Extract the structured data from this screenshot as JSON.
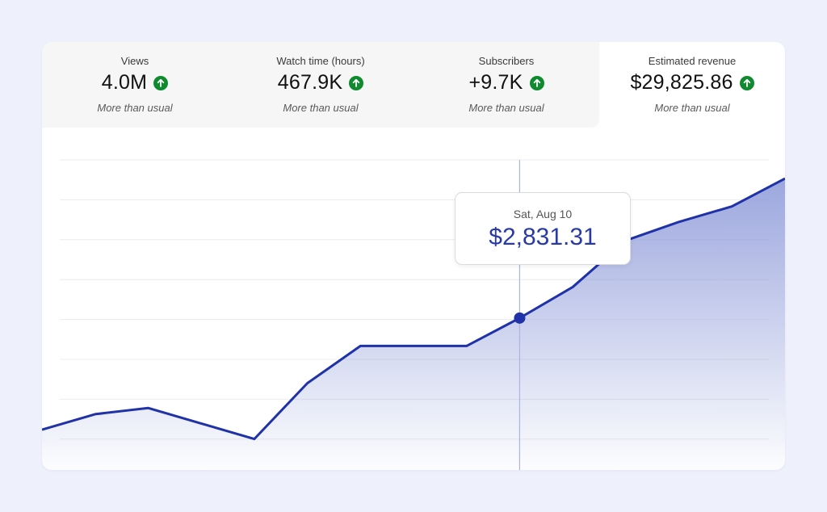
{
  "metrics": [
    {
      "label": "Views",
      "value": "4.0M",
      "note": "More than usual",
      "trend": "up-arrow-icon"
    },
    {
      "label": "Watch time (hours)",
      "value": "467.9K",
      "note": "More than usual",
      "trend": "up-arrow-icon"
    },
    {
      "label": "Subscribers",
      "value": "+9.7K",
      "note": "More than usual",
      "trend": "up-arrow-icon"
    },
    {
      "label": "Estimated revenue",
      "value": "$29,825.86",
      "note": "More than usual",
      "trend": "up-arrow-icon"
    }
  ],
  "selected_metric": "Estimated revenue",
  "tooltip": {
    "date": "Sat, Aug 10",
    "value": "$2,831.31"
  },
  "colors": {
    "page_bg": "#eef0fb",
    "line": "#1f32a8",
    "fill": "#8a97d8",
    "trend_up": "#0f8a2f",
    "tooltip_value": "#2a3aa5"
  },
  "chart_data": {
    "type": "area",
    "series": [
      {
        "values": [
          0.25,
          0.3,
          0.32,
          0.27,
          0.22,
          0.4,
          0.52,
          0.52,
          0.52,
          0.61,
          0.71,
          0.86,
          0.92,
          0.97,
          1.06
        ]
      }
    ],
    "ylim": [
      0.12,
      1.12
    ],
    "highlight_index": 9,
    "grid": true,
    "gridlines": 8
  }
}
